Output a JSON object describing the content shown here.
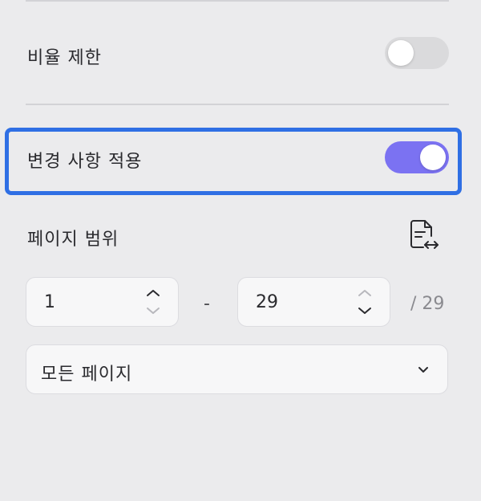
{
  "settings": {
    "aspect_ratio_label": "비율 제한",
    "aspect_ratio_enabled": false,
    "apply_changes_label": "변경 사항 적용",
    "apply_changes_enabled": true
  },
  "page_range": {
    "label": "페이지 범위",
    "from_value": "1",
    "separator": "-",
    "to_value": "29",
    "total": "/ 29",
    "preset_selected": "모든 페이지",
    "icon": "page-swap-icon"
  },
  "colors": {
    "accent": "#7b72f2",
    "focus_outline": "#2f6fe4",
    "background": "#ebebed"
  }
}
